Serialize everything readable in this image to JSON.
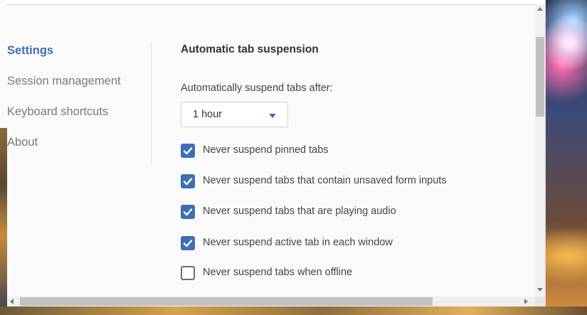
{
  "sidebar": {
    "items": [
      {
        "label": "Settings",
        "active": true
      },
      {
        "label": "Session management",
        "active": false
      },
      {
        "label": "Keyboard shortcuts",
        "active": false
      },
      {
        "label": "About",
        "active": false
      }
    ]
  },
  "main": {
    "section_title": "Automatic tab suspension",
    "suspend_after_label": "Automatically suspend tabs after:",
    "suspend_after_value": "1 hour",
    "options": [
      {
        "label": "Never suspend pinned tabs",
        "checked": true
      },
      {
        "label": "Never suspend tabs that contain unsaved form inputs",
        "checked": true
      },
      {
        "label": "Never suspend tabs that are playing audio",
        "checked": true
      },
      {
        "label": "Never suspend active tab in each window",
        "checked": true
      },
      {
        "label": "Never suspend tabs when offline",
        "checked": false
      }
    ]
  },
  "colors": {
    "accent": "#3c6fb5",
    "text": "#444444",
    "muted": "#7a7a7a",
    "panel_bg": "#fafafa"
  }
}
